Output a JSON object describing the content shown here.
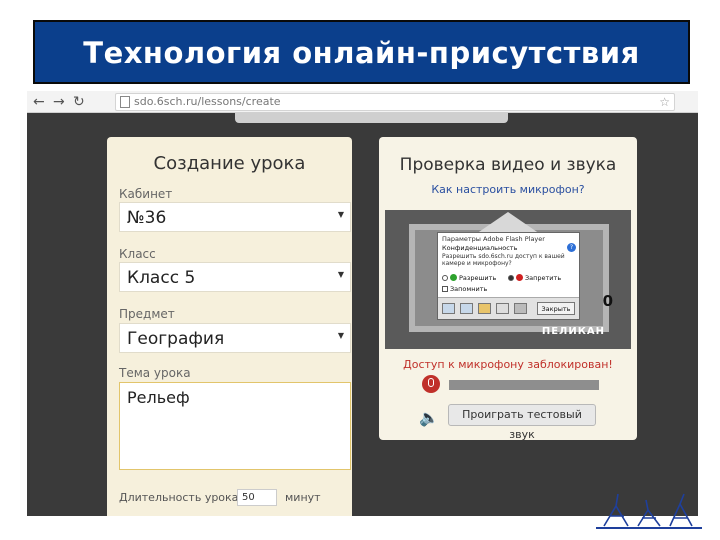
{
  "slide": {
    "title": "Технология онлайн-присутствия"
  },
  "browser": {
    "url": "sdo.6sch.ru/lessons/create",
    "back_icon": "arrow-left-icon",
    "forward_icon": "arrow-right-icon",
    "reload_icon": "reload-icon"
  },
  "lesson_form": {
    "title": "Создание урока",
    "fields": [
      {
        "label": "Кабинет",
        "value": "№36"
      },
      {
        "label": "Класс",
        "value": "Класс 5"
      },
      {
        "label": "Предмет",
        "value": "География"
      }
    ],
    "topic": {
      "label": "Тема урока",
      "value": "Рельеф"
    },
    "duration": {
      "label": "Длительность урока:",
      "value": "50",
      "unit": "минут"
    }
  },
  "av_check": {
    "title": "Проверка видео и звука",
    "link": "Как настроить микрофон?",
    "video": {
      "logo": "ПЕЛИКАН",
      "digit": "0"
    },
    "flash_dialog": {
      "title": "Параметры Adobe Flash Player",
      "subtitle": "Конфиденциальность",
      "text": "Разрешить sdo.6sch.ru доступ к вашей камере и микрофону?",
      "allow": "Разрешить",
      "deny": "Запретить",
      "remember": "Запомнить",
      "close": "Закрыть",
      "help": "?"
    },
    "mic_warning": "Доступ к микрофону заблокирован!",
    "test_sound_button": "Проиграть тестовый звук"
  }
}
